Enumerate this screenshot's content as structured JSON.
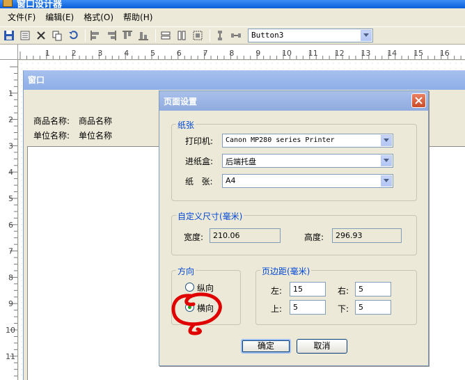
{
  "app": {
    "title": "窗口设计器"
  },
  "menu": [
    {
      "label": "文件(F)"
    },
    {
      "label": "编辑(E)"
    },
    {
      "label": "格式(O)"
    },
    {
      "label": "帮助(H)"
    }
  ],
  "toolbar": {
    "control_combo_value": "Button3",
    "icons": [
      "save-icon",
      "properties-icon",
      "delete-icon",
      "copy-icon",
      "undo-icon",
      "align-left-icon",
      "align-right-icon",
      "align-top-icon",
      "align-bottom-icon",
      "same-width-icon",
      "same-height-icon",
      "same-size-icon",
      "vertical-spacing-icon",
      "horizontal-spacing-icon"
    ]
  },
  "ruler": {
    "horizontal": [
      "1",
      "2",
      "3",
      "4",
      "5",
      "6",
      "7",
      "8",
      "9",
      "10",
      "11",
      "12",
      "13",
      "14",
      "15",
      "16"
    ],
    "vertical": [
      "1",
      "2",
      "3",
      "4",
      "5",
      "6",
      "7",
      "8",
      "9",
      "10",
      "11"
    ]
  },
  "design_window": {
    "title": "窗口",
    "fields": [
      {
        "label": "商品名称:",
        "value": "商品名称"
      },
      {
        "label": "单位名称:",
        "value": "单位名称"
      }
    ]
  },
  "dialog": {
    "title": "页面设置",
    "paper": {
      "title": "纸张",
      "printer_label": "打印机:",
      "printer_value": "Canon MP280 series Printer",
      "tray_label": "进纸盒:",
      "tray_value": "后端托盘",
      "size_label": "纸   张:",
      "size_value": "A4"
    },
    "custom_size": {
      "title": "自定义尺寸(毫米)",
      "width_label": "宽度:",
      "width_value": "210.06",
      "height_label": "高度:",
      "height_value": "296.93"
    },
    "orientation": {
      "title": "方向",
      "portrait_label": "纵向",
      "landscape_label": "横向",
      "selected": "横向"
    },
    "margins": {
      "title": "页边距(毫米)",
      "left_label": "左:",
      "left_value": "15",
      "right_label": "右:",
      "right_value": "5",
      "top_label": "上:",
      "top_value": "5",
      "bottom_label": "下:",
      "bottom_value": "5"
    },
    "ok_label": "确定",
    "cancel_label": "取消"
  },
  "colors": {
    "group_title": "#0046d5",
    "annotation": "#e00000",
    "caption_blue": "#8eaee7"
  }
}
